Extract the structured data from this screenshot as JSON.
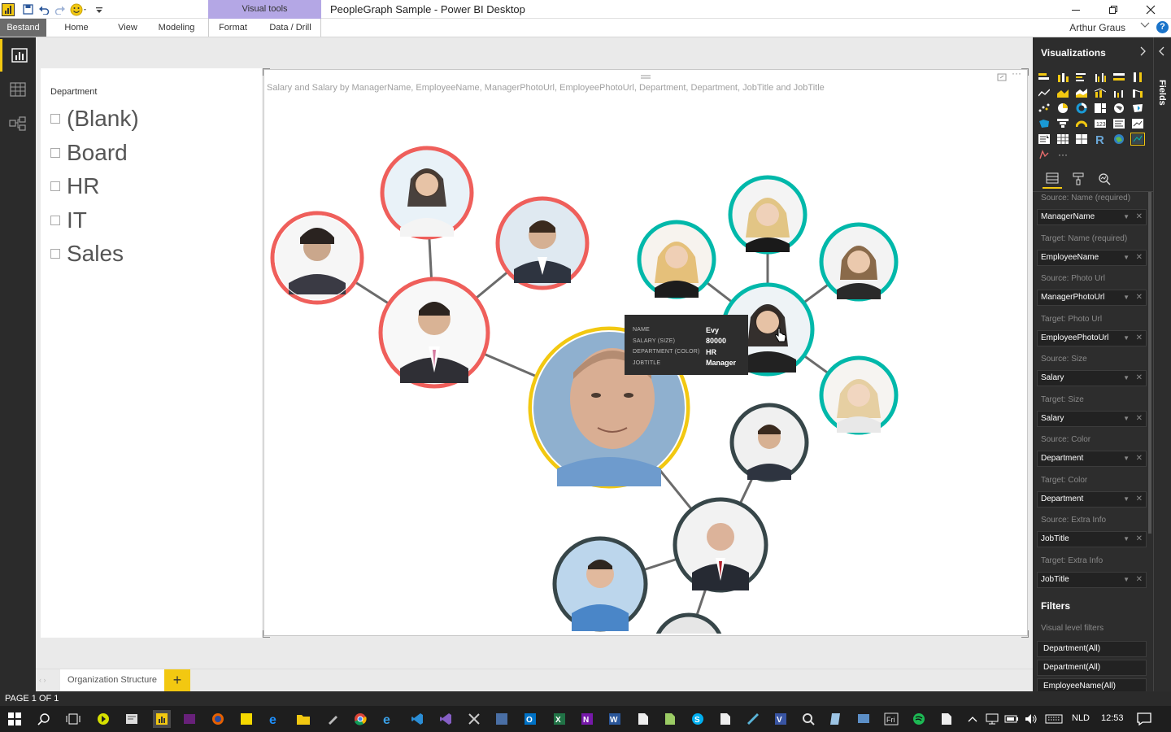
{
  "titlebar": {
    "context_tab": "Visual tools",
    "title": "PeopleGraph Sample - Power BI Desktop",
    "minimize_icon": "minimize-icon",
    "restore_icon": "restore-icon",
    "close_icon": "close-icon"
  },
  "ribbon": {
    "tabs": [
      "Bestand",
      "Home",
      "View",
      "Modeling",
      "Format",
      "Data / Drill"
    ],
    "user": "Arthur Graus"
  },
  "slicer": {
    "title": "Department",
    "items": [
      "(Blank)",
      "Board",
      "HR",
      "IT",
      "Sales"
    ]
  },
  "visual": {
    "subtitle": "Salary and Salary by ManagerName, EmployeeName, ManagerPhotoUrl, EmployeePhotoUrl, Department, Department, JobTitle and JobTitle",
    "colors": {
      "board": "#f2c811",
      "hr": "#ef5f5b",
      "it": "#01b8aa",
      "sales": "#374649"
    }
  },
  "tooltip": {
    "rows": [
      {
        "key": "NAME",
        "value": "Evy"
      },
      {
        "key": "SALARY (SIZE)",
        "value": "80000"
      },
      {
        "key": "DEPARTMENT (COLOR)",
        "value": "HR"
      },
      {
        "key": "JOBTITLE",
        "value": "Manager"
      }
    ]
  },
  "pages": {
    "tab": "Organization Structure",
    "add": "+"
  },
  "status": {
    "page": "PAGE 1 OF 1"
  },
  "viz_pane": {
    "title": "Visualizations",
    "wells": [
      {
        "label": "Source: Name (required)",
        "field": "ManagerName"
      },
      {
        "label": "Target: Name (required)",
        "field": "EmployeeName"
      },
      {
        "label": "Source: Photo Url",
        "field": "ManagerPhotoUrl"
      },
      {
        "label": "Target: Photo Url",
        "field": "EmployeePhotoUrl"
      },
      {
        "label": "Source: Size",
        "field": "Salary"
      },
      {
        "label": "Target: Size",
        "field": "Salary"
      },
      {
        "label": "Source: Color",
        "field": "Department"
      },
      {
        "label": "Target: Color",
        "field": "Department"
      },
      {
        "label": "Source: Extra Info",
        "field": "JobTitle"
      },
      {
        "label": "Target: Extra Info",
        "field": "JobTitle"
      }
    ],
    "filters_title": "Filters",
    "filters_sub": "Visual level filters",
    "filters": [
      "Department(All)",
      "Department(All)",
      "EmployeeName(All)"
    ]
  },
  "fields_pane": {
    "label": "Fields"
  },
  "taskbar": {
    "lang": "NLD",
    "time": "12:53"
  }
}
